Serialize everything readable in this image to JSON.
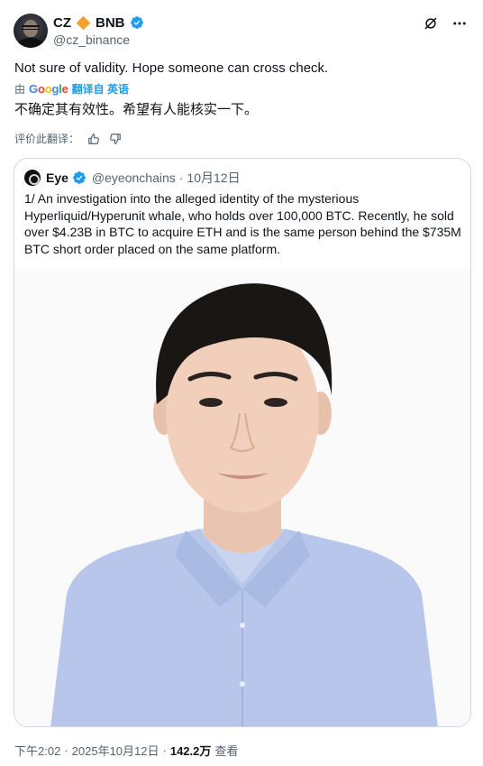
{
  "author": {
    "display_name": "CZ",
    "badge_text": "BNB",
    "handle": "@cz_binance"
  },
  "tweet": {
    "text": "Not sure of validity. Hope someone can cross check.",
    "translated_by_prefix": "由",
    "translated_by_google": "Google",
    "translated_by_suffix": "翻译自 英语",
    "translated_text": "不确定其有效性。希望有人能核实一下。",
    "rate_translation": "评价此翻译："
  },
  "quote": {
    "display_name": "Eye",
    "handle": "@eyeonchains",
    "separator": "·",
    "date": "10月12日",
    "text": "1/ An investigation into the alleged identity of the mysterious Hyperliquid/Hyperunit whale, who holds over 100,000 BTC. Recently, he sold over $4.23B in BTC to acquire ETH and is the same person behind the $735M BTC short order placed on the same platform."
  },
  "footer": {
    "time": "下午2:02",
    "separator": "·",
    "date": "2025年10月12日",
    "views_count": "142.2万",
    "views_label": "查看"
  },
  "icons": {
    "diamond": "diamond-icon",
    "verified": "verified-icon",
    "grok": "grok-icon",
    "more": "more-icon",
    "thumbs_up": "thumbs-up-icon",
    "thumbs_down": "thumbs-down-icon"
  },
  "colors": {
    "accent": "#1d9bf0",
    "diamond": "#f3a12d",
    "text_secondary": "#536471",
    "shirt": "#b7c6ea"
  }
}
